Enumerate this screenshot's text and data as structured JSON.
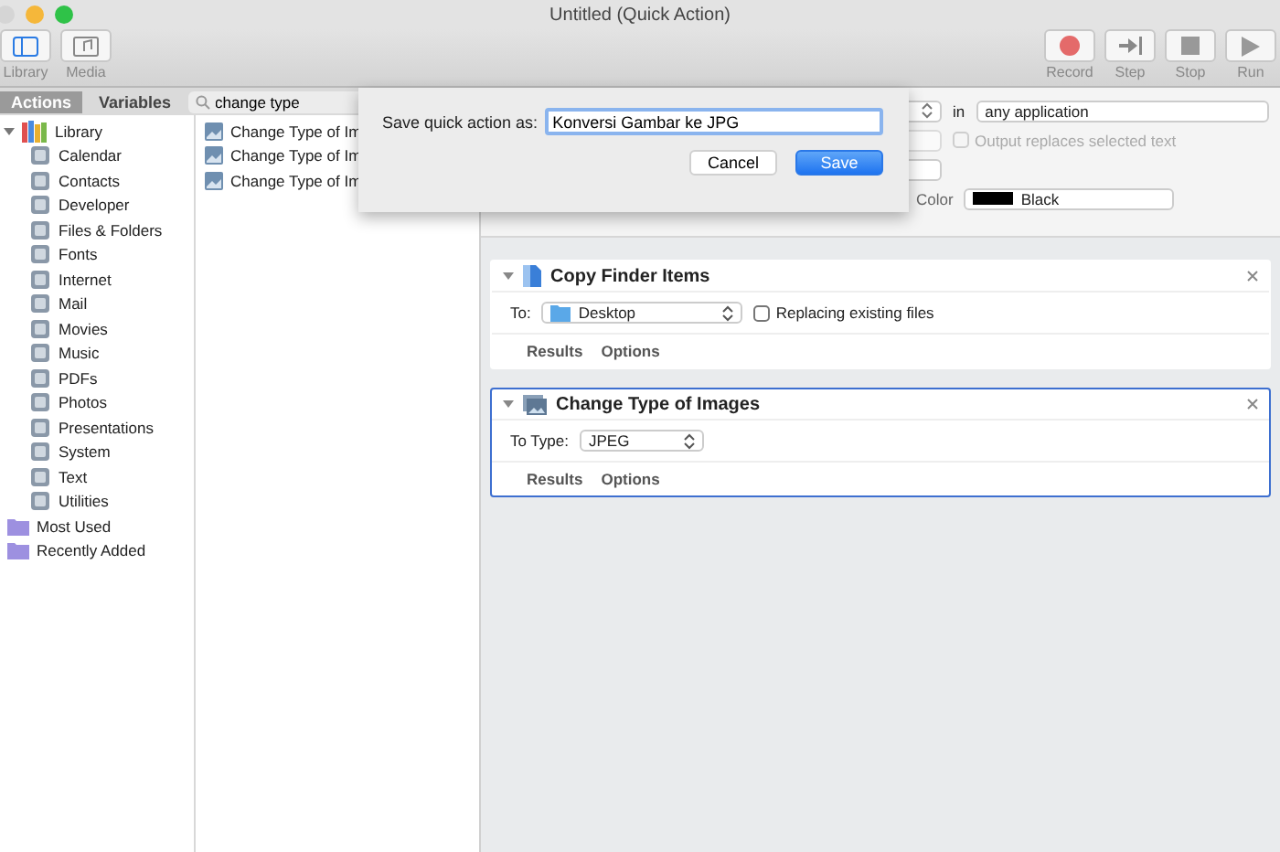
{
  "window": {
    "title": "Untitled (Quick Action)"
  },
  "toolbar": {
    "left": [
      {
        "label": "Library",
        "selected": true
      },
      {
        "label": "Media",
        "selected": false
      }
    ],
    "right": [
      {
        "label": "Record",
        "kind": "record"
      },
      {
        "label": "Step",
        "kind": "step"
      },
      {
        "label": "Stop",
        "kind": "stop"
      },
      {
        "label": "Run",
        "kind": "run"
      }
    ]
  },
  "tabs": [
    {
      "label": "Actions",
      "selected": true
    },
    {
      "label": "Variables",
      "selected": false
    }
  ],
  "search": {
    "value": "change type"
  },
  "sidebar": {
    "items": [
      {
        "label": "Library",
        "expanded": true,
        "children": [
          {
            "label": "Calendar"
          },
          {
            "label": "Contacts"
          },
          {
            "label": "Developer"
          },
          {
            "label": "Files & Folders"
          },
          {
            "label": "Fonts"
          },
          {
            "label": "Internet"
          },
          {
            "label": "Mail"
          },
          {
            "label": "Movies"
          },
          {
            "label": "Music"
          },
          {
            "label": "PDFs"
          },
          {
            "label": "Photos"
          },
          {
            "label": "Presentations"
          },
          {
            "label": "System"
          },
          {
            "label": "Text"
          },
          {
            "label": "Utilities"
          }
        ]
      },
      {
        "label": "Most Used"
      },
      {
        "label": "Recently Added"
      }
    ]
  },
  "results": [
    {
      "label": "Change Type of Im"
    },
    {
      "label": "Change Type of Im"
    },
    {
      "label": "Change Type of Im"
    }
  ],
  "workflow_header": {
    "in_label": "in",
    "application": "any application",
    "output_replaces": {
      "label": "Output replaces selected text",
      "checked": false,
      "disabled": true
    },
    "color_label": "Color",
    "color_value": "Black"
  },
  "actions": [
    {
      "title": "Copy Finder Items",
      "selected": false,
      "kind": "copy",
      "field_label": "To:",
      "field_value": "Desktop",
      "checkbox": {
        "label": "Replacing existing files",
        "checked": false
      },
      "tabs": [
        "Results",
        "Options"
      ]
    },
    {
      "title": "Change Type of Images",
      "selected": true,
      "kind": "images",
      "field_label": "To Type:",
      "field_value": "JPEG",
      "tabs": [
        "Results",
        "Options"
      ]
    }
  ],
  "sheet": {
    "label": "Save quick action as:",
    "value": "Konversi Gambar ke JPG",
    "buttons": [
      {
        "label": "Cancel",
        "kind": "cancel"
      },
      {
        "label": "Save",
        "kind": "default"
      }
    ]
  }
}
